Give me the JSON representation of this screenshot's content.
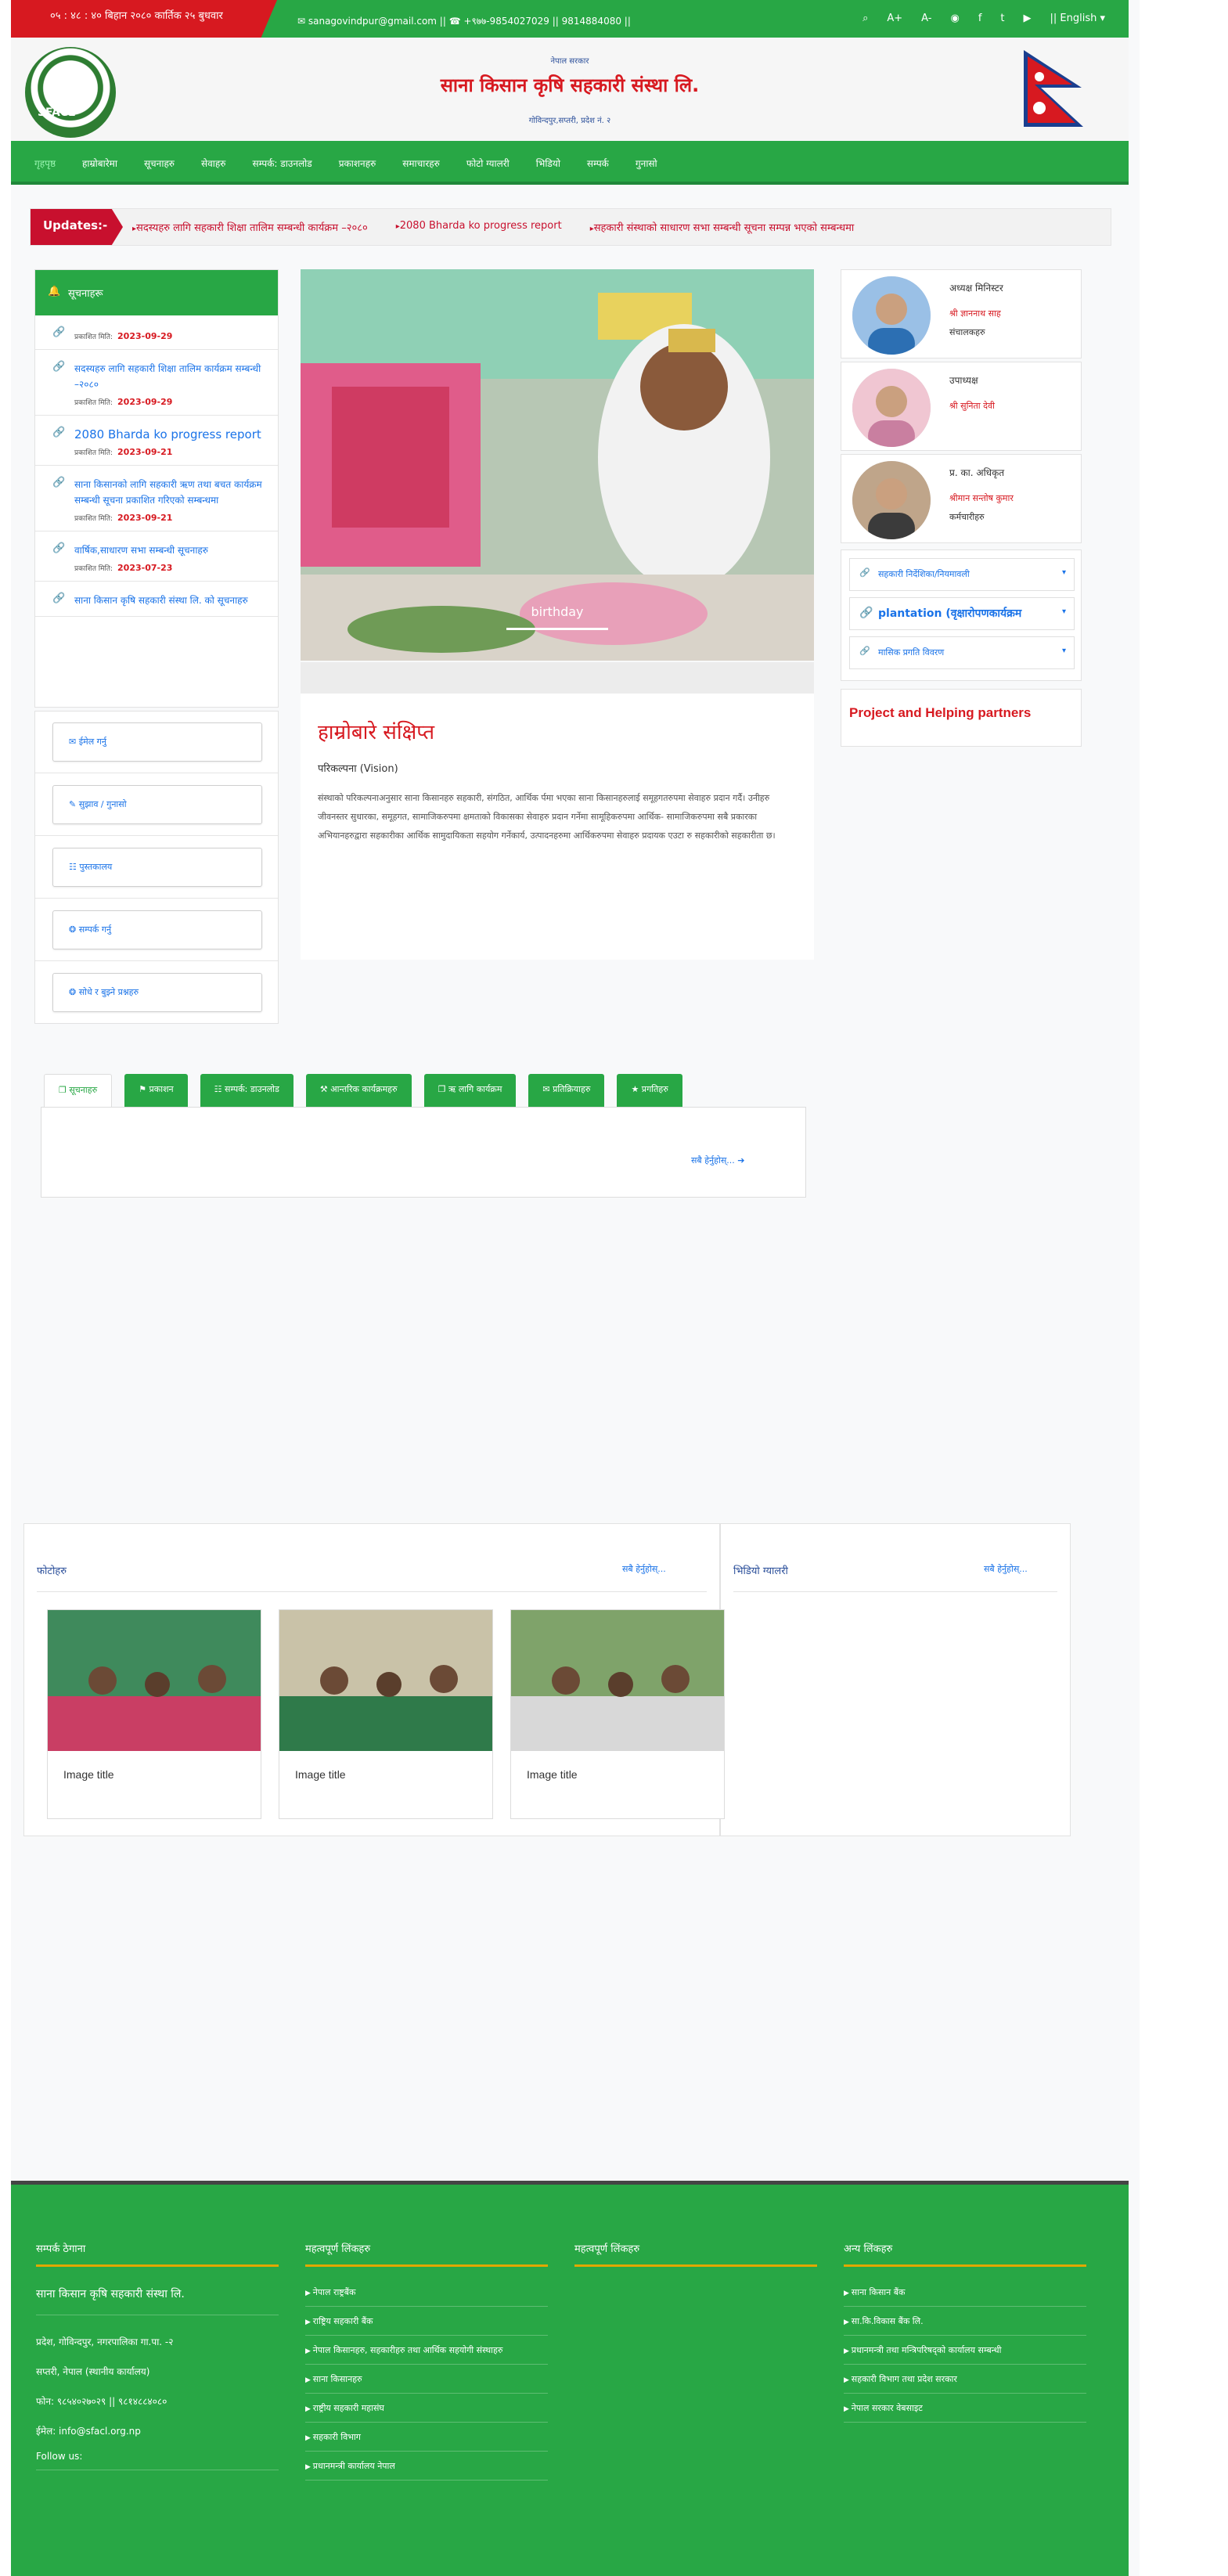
{
  "topbar": {
    "datetime": "०५ : ४८ : ४० बिहान   २०८० कार्तिक २५ बुधवार",
    "contact": "✉ sanagovindpur@gmail.com || ☎ +९७७-9854027029 || 9814884080 ||",
    "icons": {
      "search": "⌕",
      "font_plus": "A+",
      "font_minus": "A-",
      "eye": "◉",
      "facebook": "f",
      "twitter": "t",
      "youtube": "▶"
    },
    "language": "|| English ▾"
  },
  "header": {
    "small_line": "नेपाल सरकार",
    "org_name": "साना किसान कृषि सहकारी संस्था लि.",
    "address": "गोविन्दपुर,सप्तरी, प्रदेश नं. २",
    "logo_text": "SFACL"
  },
  "nav": {
    "items": [
      "गृहपृष्ठ",
      "हाम्रोबारेमा",
      "सूचनाहरु",
      "सेवाहरु",
      "सम्पर्क: डाउनलोड",
      "प्रकाशनहरु",
      "समाचारहरु",
      "फोटो ग्यालरी",
      "भिडियो",
      "सम्पर्क",
      "गुनासो"
    ]
  },
  "ticker": {
    "label": "Updates:-",
    "items": [
      "सदस्यहरु लागि सहकारी शिक्षा तालिम सम्बन्धी कार्यक्रम –२०८०",
      "2080 Bharda ko progress report",
      "सहकारी संस्थाको साधारण सभा सम्बन्धी सूचना सम्पन्न भएको सम्बन्धमा"
    ]
  },
  "notices": {
    "title": "सूचनाहरू",
    "date_label": "प्रकाशित मिति:",
    "items": [
      {
        "title": "",
        "date": "2023-09-29",
        "big": false
      },
      {
        "title": "सदस्यहरु लागि सहकारी शिक्षा तालिम कार्यक्रम सम्बन्धी –२०८०",
        "date": "2023-09-29",
        "big": false
      },
      {
        "title": "2080 Bharda ko progress report",
        "date": "2023-09-21",
        "big": true
      },
      {
        "title": "साना किसानको लागि सहकारी ऋण तथा बचत कार्यक्रम सम्बन्धी सूचना प्रकाशित गरिएको सम्बन्धमा",
        "date": "2023-09-21",
        "big": false
      },
      {
        "title": "वार्षिक,साधारण सभा सम्बन्धी सूचनाहरु",
        "date": "2023-07-23",
        "big": false
      },
      {
        "title": "साना किसान कृषि सहकारी संस्था लि. को सूचनाहरु",
        "date": "",
        "big": false
      }
    ]
  },
  "quick_links": [
    "✉ ईमेल गर्नु",
    "✎ सुझाव / गुनासो",
    "☷ पुस्तकालय",
    "❂ सम्पर्क गर्नु",
    "❂ सोधे र बुझ्ने प्रश्नहरु"
  ],
  "slider": {
    "caption": "birthday"
  },
  "about": {
    "title": "हाम्रोबारे संक्षिप्त",
    "vision": "परिकल्पना (Vision)",
    "text": "संस्थाको परिकल्पनाअनुसार साना किसानहरु सहकारी, संगठित, आर्थिक र्पमा भएका साना किसानहरुलाई समूहगतरुपमा सेवाहरु प्रदान गर्दै। उनीहरु जीवनस्तर सुधारका, समूहगत, सामाजिकरुपमा क्षमताको विकासका सेवाहरु प्रदान गर्नेमा सामूहिकरुपमा आर्थिक- सामाजिकरुपमा सबै प्रकारका अभियानहरुद्वारा सहकारीका आर्थिक सामुदायिकता सहयोग गर्नेकार्य, उत्पादनहरुमा आर्थिकरुपमा सेवाहरु प्रदायक एउटा रु सहकारीको सहकारीता छ।"
  },
  "people": [
    {
      "role": "अध्यक्ष मिनिस्टर",
      "name": "श्री ज्ञाननाथ साह",
      "title": "संचालकहरु"
    },
    {
      "role": "उपाध्यक्ष",
      "name": "श्री सुनिता देवी",
      "title": ""
    },
    {
      "role": "प्र. का. अधिकृत",
      "name": "श्रीमान सन्तोष कुमार",
      "title": "कर्मचारीहरु"
    }
  ],
  "accordion": [
    {
      "label": "सहकारी निर्देशिका/नियमावली",
      "bold": false
    },
    {
      "label": "plantation (वृक्षारोपणकार्यक्रम",
      "bold": true
    },
    {
      "label": "मासिक प्रगति विवरण",
      "bold": false
    }
  ],
  "partners_title": "Project and Helping partners",
  "tabs": {
    "items": [
      "❐ सूचनाहरु",
      "⚑ प्रकाशन",
      "☷ सम्पर्क: डाउनलोड",
      "⚒ आन्तरिक कार्यक्रमहरु",
      "❐ ऋ लागि कार्यक्रम",
      "✉ प्रतिक्रियाहरु",
      "★ प्रगतिहरु"
    ],
    "view_more": "सबै हेर्नुहोस्...  ➔"
  },
  "gallery": {
    "title": "फोटोहरु",
    "view_more": "सबै हेर्नुहोस्...",
    "cards": [
      "Image title",
      "Image title",
      "Image title"
    ]
  },
  "video": {
    "title": "भिडियो ग्यालरी",
    "view_more": "सबै हेर्नुहोस्..."
  },
  "footer": {
    "col1_title": "सम्पर्क ठेगाना",
    "org": "साना किसान कृषि सहकारी संस्था लि.",
    "addr1": "प्रदेश, गोविन्दपुर, नगरपालिका गा.पा. -२",
    "addr2": "सप्तरी, नेपाल (स्थानीय कार्यालय)",
    "phone": "फोन: ९८५४०२७०२९ || ९८१४८८४०८०",
    "email": "ईमेल: info@sfacl.org.np",
    "follow": "Follow us:",
    "col2_title": "महत्वपूर्ण लिंकहरु",
    "col2_items": [
      "नेपाल राष्ट्रबैंक",
      "राष्ट्रिय सहकारी बैंक",
      "नेपाल किसानहरु, सहकारीहरु तथा आर्थिक सहयोगी संस्थाहरु",
      "साना किसानहरु",
      "राष्ट्रीय सहकारी महासंघ",
      "सहकारी विभाग",
      "प्रधानमन्त्री कार्यालय नेपाल"
    ],
    "col3_title": "महत्वपूर्ण लिंकहरु",
    "col4_title": "अन्य लिंकहरु",
    "col4_items": [
      "साना किसान बैंक",
      "सा.कि.विकास बैंक लि.",
      "प्रधानमन्त्री तथा मन्त्रिपरिषद्को कार्यालय सम्बन्धी",
      "सहकारी विभाग तथा प्रदेश सरकार",
      "नेपाल सरकार वेबसाइट"
    ]
  },
  "colors": {
    "green": "#28a745",
    "red": "#d71920",
    "blue": "#1a73e8"
  }
}
